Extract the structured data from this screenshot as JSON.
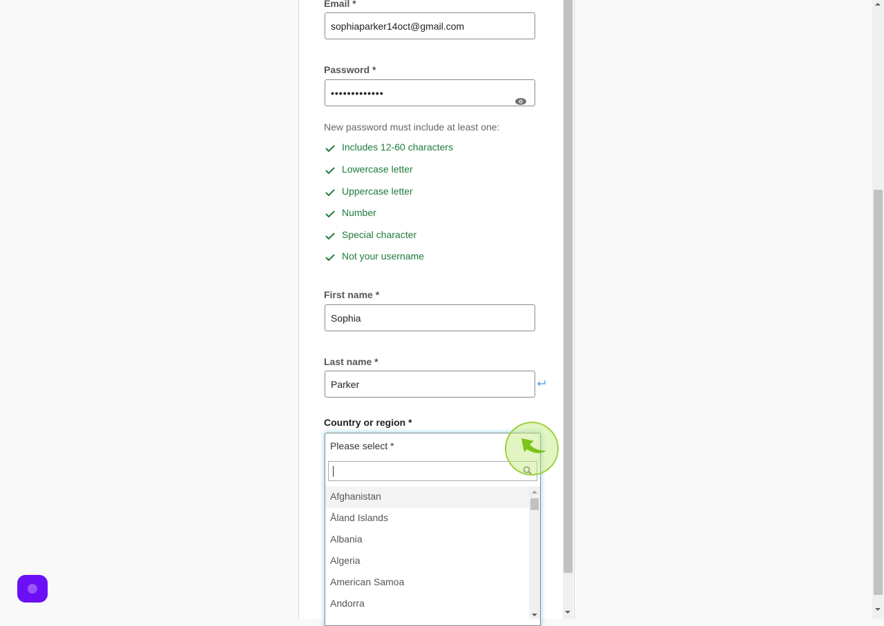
{
  "form": {
    "email": {
      "label": "Email *",
      "value": "sophiaparker14oct@gmail.com"
    },
    "password": {
      "label": "Password *",
      "masked_value": "•••••••••••••",
      "toggle_icon": "eye-icon"
    },
    "password_rules": {
      "hint": "New password must include at least one:",
      "status_color": "#1f7a3a",
      "items": [
        {
          "label": "Includes 12-60 characters",
          "met": true
        },
        {
          "label": "Lowercase letter",
          "met": true
        },
        {
          "label": "Uppercase letter",
          "met": true
        },
        {
          "label": "Number",
          "met": true
        },
        {
          "label": "Special character",
          "met": true
        },
        {
          "label": "Not your username",
          "met": true
        }
      ]
    },
    "first_name": {
      "label": "First name *",
      "value": "Sophia"
    },
    "last_name": {
      "label": "Last name *",
      "value": "Parker"
    },
    "country": {
      "label": "Country or region *",
      "selected": "Please select *",
      "search_value": "",
      "options": [
        "Afghanistan",
        "Åland Islands",
        "Albania",
        "Algeria",
        "American Samoa",
        "Andorra"
      ],
      "highlighted_option": "Afghanistan"
    }
  },
  "widget": {
    "icon": "chat-launcher-icon",
    "color": "#6b0ff7"
  },
  "click_indicator": {
    "color": "#9ad03a"
  }
}
